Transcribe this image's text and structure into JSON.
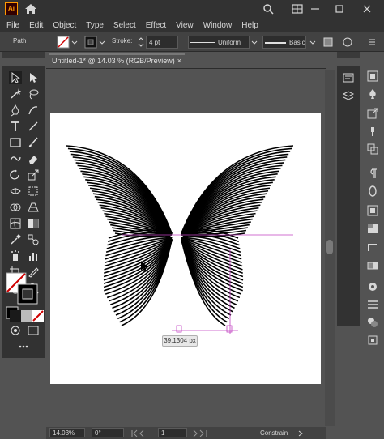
{
  "app": {
    "logo_text": "Ai",
    "menu": [
      "File",
      "Edit",
      "Object",
      "Type",
      "Select",
      "Effect",
      "View",
      "Window",
      "Help"
    ]
  },
  "control_bar": {
    "selection_label": "Path",
    "stroke_label": "Stroke:",
    "stroke_weight": "4 pt",
    "profile_label": "Uniform",
    "brush_label": "Basic"
  },
  "document": {
    "tab_title": "Untitled-1* @ 14.03 % (RGB/Preview)",
    "close_glyph": "×"
  },
  "canvas": {
    "measure_tooltip": "39.1304 px"
  },
  "status_bar": {
    "zoom": "14.03%",
    "rotation": "0°",
    "artboard_number": "1",
    "mode": "Constrain"
  },
  "colors": {
    "app_background": "#535353",
    "panel": "#323232",
    "accent_guide": "#c040c0",
    "fill_none_stroke": "#d00000"
  }
}
